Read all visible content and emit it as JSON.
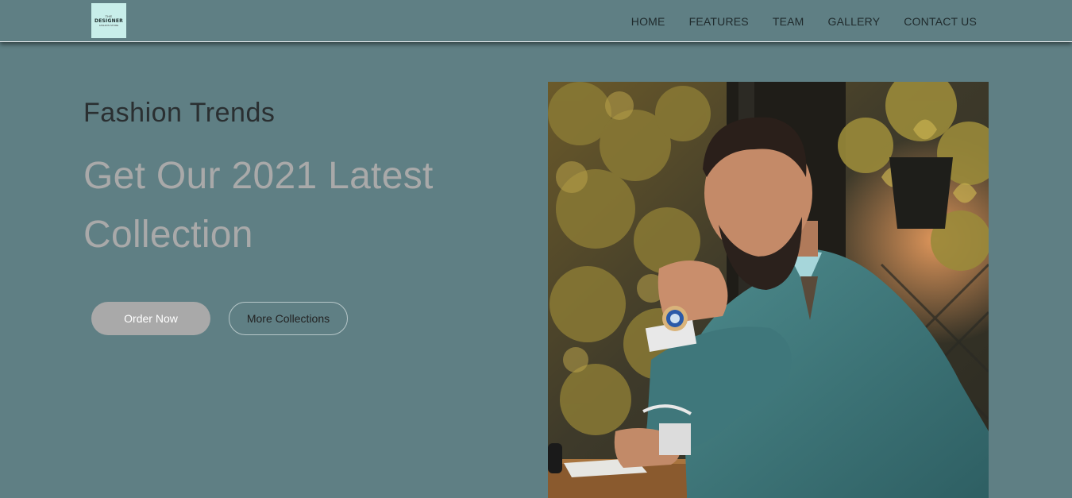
{
  "logo": {
    "top_text": "THE",
    "main_text": "DESIGNER",
    "sub_text": "FASHION STORE"
  },
  "nav": {
    "items": [
      "HOME",
      "FEATURES",
      "TEAM",
      "GALLERY",
      "CONTACT US"
    ]
  },
  "hero": {
    "subtitle": "Fashion Trends",
    "title": "Get Our 2021 Latest Collection",
    "primary_button": "Order Now",
    "secondary_button": "More Collections"
  },
  "colors": {
    "background": "#5f7f84",
    "title_gray": "#a9a9a9",
    "logo_bg": "#c8eeea"
  },
  "image": {
    "subject": "bearded-man-in-teal-suit-with-watch"
  }
}
